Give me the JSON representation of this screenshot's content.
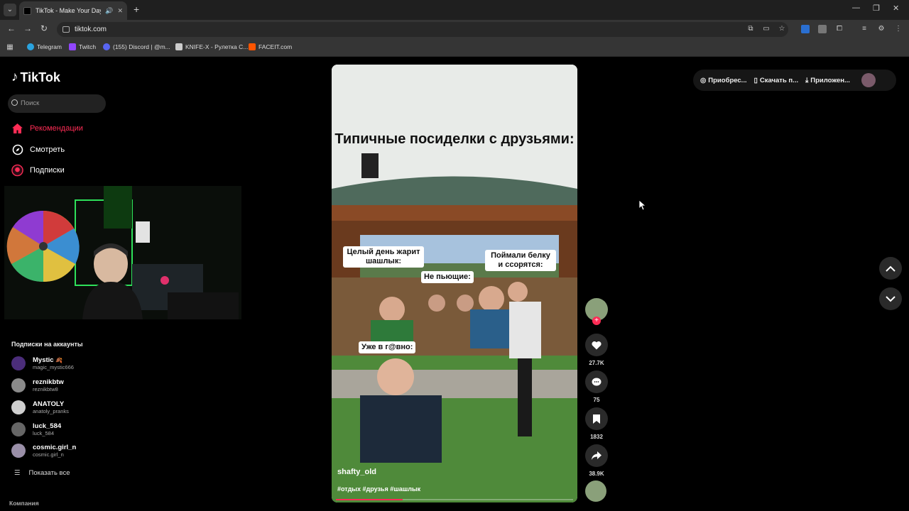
{
  "browser": {
    "tab_title": "TikTok - Make Your Day",
    "url": "tiktok.com",
    "bookmarks": [
      {
        "label": "Telegram",
        "color": "#2aa3df"
      },
      {
        "label": "Twitch",
        "color": "#9146ff"
      },
      {
        "label": "(155) Discord | @m...",
        "color": "#5865f2"
      },
      {
        "label": "KNIFE-X - Рулетка С...",
        "color": "#cccccc"
      },
      {
        "label": "FACEIT.com",
        "color": "#ff5500"
      }
    ]
  },
  "sidebar": {
    "logo": "TikTok",
    "search_placeholder": "Поиск",
    "nav": [
      {
        "label": "Рекомендации",
        "icon": "home-icon",
        "active": true
      },
      {
        "label": "Смотреть",
        "icon": "compass-icon",
        "active": false
      },
      {
        "label": "Подписки",
        "icon": "following-icon",
        "active": false
      }
    ],
    "following_heading": "Подписки на аккаунты",
    "accounts": [
      {
        "name": "Mystic",
        "badge": "🍂",
        "handle": "magic_mystic666",
        "color": "#4b2d7a"
      },
      {
        "name": "reznikbtw",
        "handle": "reznikbtw8",
        "color": "#8a8a8a"
      },
      {
        "name": "ANATOLY",
        "handle": "anatoly_pranks",
        "color": "#cfcfcf"
      },
      {
        "name": "luck_584",
        "handle": "luck_584",
        "color": "#666666"
      },
      {
        "name": "cosmic.girl_n",
        "handle": "cosmic.girl_n",
        "color": "#9a8fa8"
      }
    ],
    "show_all": "Показать все",
    "company": "Компания"
  },
  "video": {
    "title": "Типичные посиделки с друзьями:",
    "captions": {
      "left": "Целый день жарит шашлык:",
      "middle": "Не пьющие:",
      "right": "Поймали белку и ссорятся:",
      "bottom": "Уже в г@вно:"
    },
    "author": "shafty_old",
    "hashtags": "#отдых #друзья #шашлык",
    "progress": 0.28
  },
  "actions": {
    "likes": "27.7K",
    "comments": "75",
    "saves": "1832",
    "shares": "38.9K"
  },
  "topbar": {
    "buy": "Приобрес...",
    "download": "Скачать п...",
    "app": "Приложен..."
  },
  "colors": {
    "accent": "#fe2c55"
  }
}
